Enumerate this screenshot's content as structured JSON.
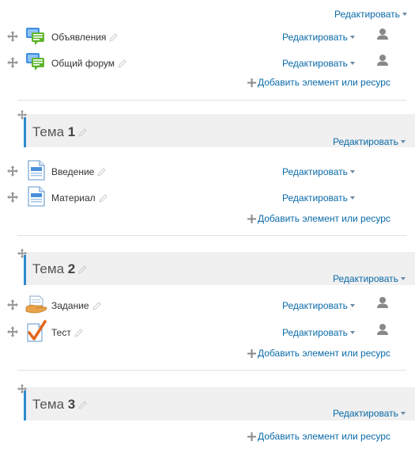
{
  "top_edit_label": "Редактировать",
  "general_section": {
    "activities": [
      {
        "name": "Объявления",
        "icon": "forum-icon",
        "edit_label": "Редактировать"
      },
      {
        "name": "Общий форум",
        "icon": "forum-icon",
        "edit_label": "Редактировать"
      }
    ],
    "add_label": "Добавить элемент или ресурс"
  },
  "sections": [
    {
      "title_prefix": "Тема",
      "title_number": "1",
      "edit_label": "Редактировать",
      "activities": [
        {
          "name": "Введение",
          "icon": "page-icon",
          "edit_label": "Редактировать"
        },
        {
          "name": "Материал",
          "icon": "page-icon",
          "edit_label": "Редактировать"
        }
      ],
      "add_label": "Добавить элемент или ресурс"
    },
    {
      "title_prefix": "Тема",
      "title_number": "2",
      "edit_label": "Редактировать",
      "activities": [
        {
          "name": "Задание",
          "icon": "assignment-icon",
          "edit_label": "Редактировать"
        },
        {
          "name": "Тест",
          "icon": "quiz-icon",
          "edit_label": "Редактировать"
        }
      ],
      "add_label": "Добавить элемент или ресурс"
    },
    {
      "title_prefix": "Тема",
      "title_number": "3",
      "edit_label": "Редактировать",
      "activities": [],
      "add_label": "Добавить элемент или ресурс"
    }
  ],
  "colors": {
    "link": "#0a6aa8",
    "section_bar": "#2f8ad0",
    "section_bg": "#f0f0f0"
  }
}
